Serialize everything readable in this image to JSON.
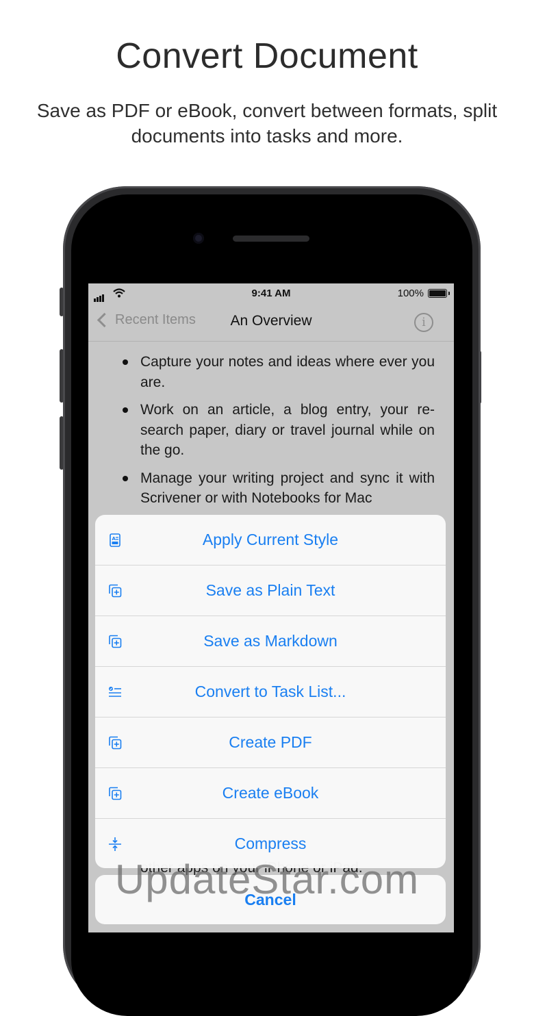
{
  "header": {
    "title": "Convert Document",
    "subtitle": "Save as PDF or eBook, convert between formats, split documents into tasks and more."
  },
  "status_bar": {
    "time": "9:41 AM",
    "battery": "100%"
  },
  "nav": {
    "back_label": "Recent Items",
    "title": "An Overview",
    "info_glyph": "i"
  },
  "document": {
    "bullets": [
      "Capture your notes and ideas where ever you are.",
      "Work on an article, a blog entry, your re-search paper, diary or travel journal while on the go.",
      "Manage your writing project and sync it with Scrivener or with Notebooks for Mac"
    ],
    "tail_text": "other apps on your iPhone or iPad."
  },
  "action_sheet": {
    "items": [
      {
        "label": "Apply Current Style",
        "icon": "style-icon"
      },
      {
        "label": "Save as Plain Text",
        "icon": "duplicate-plus-icon"
      },
      {
        "label": "Save as Markdown",
        "icon": "duplicate-plus-icon"
      },
      {
        "label": "Convert to Task List...",
        "icon": "task-list-icon"
      },
      {
        "label": "Create PDF",
        "icon": "duplicate-plus-icon"
      },
      {
        "label": "Create eBook",
        "icon": "duplicate-plus-icon"
      },
      {
        "label": "Compress",
        "icon": "compress-icon"
      }
    ],
    "cancel_label": "Cancel"
  },
  "watermark": "UpdateStar.com",
  "colors": {
    "accent": "#1a7ff1",
    "screen_dim": "#c7c7c7",
    "phone_body": "#2a2a2c"
  }
}
